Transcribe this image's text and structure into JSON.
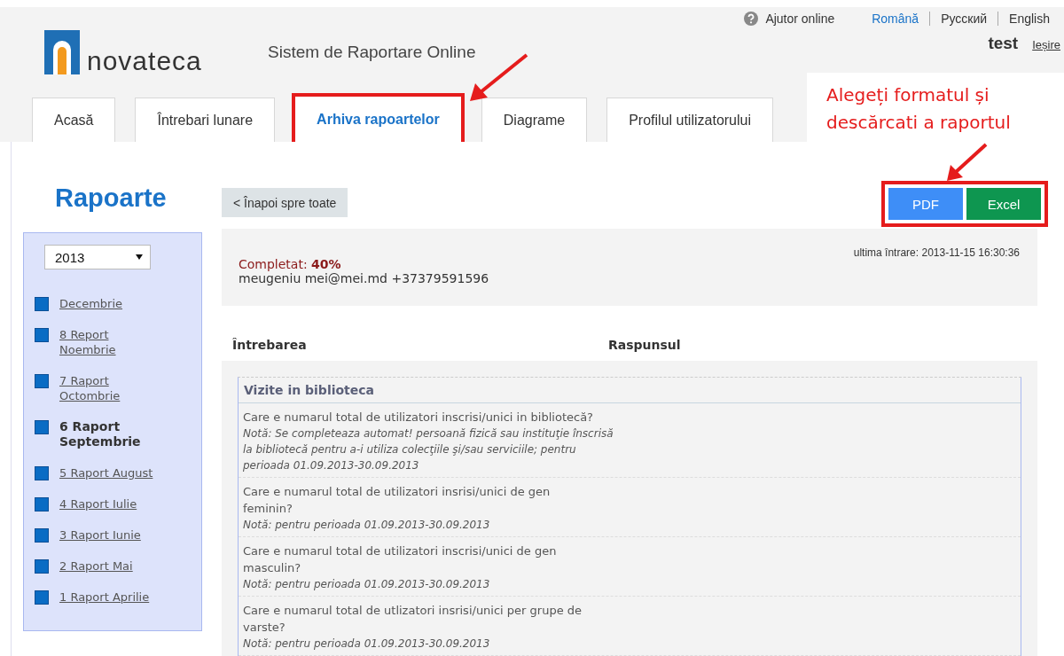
{
  "header": {
    "help_link": "Ajutor online",
    "languages": [
      {
        "label": "Română",
        "selected": true
      },
      {
        "label": "Русский",
        "selected": false
      },
      {
        "label": "English",
        "selected": false
      }
    ],
    "logo_text": "novateca",
    "site_title": "Sistem de Raportare Online",
    "user": "test",
    "logout": "Ieșire"
  },
  "tabs": [
    {
      "label": "Acasă",
      "selected": false,
      "highlighted": false
    },
    {
      "label": "Întrebari lunare",
      "selected": false,
      "highlighted": false
    },
    {
      "label": "Arhiva rapoartelor",
      "selected": true,
      "highlighted": true
    },
    {
      "label": "Diagrame",
      "selected": false,
      "highlighted": false
    },
    {
      "label": "Profilul utilizatorului",
      "selected": false,
      "highlighted": false
    }
  ],
  "callout": "Alegeți formatul și descărcati a raportul",
  "sidebar": {
    "title": "Rapoarte",
    "year": "2013",
    "items": [
      {
        "label": "Decembrie",
        "selected": false
      },
      {
        "label": "8 Report Noembrie",
        "selected": false
      },
      {
        "label": "7 Raport Octombrie",
        "selected": false
      },
      {
        "label": "6 Raport Septembrie",
        "selected": true
      },
      {
        "label": "5 Raport August",
        "selected": false
      },
      {
        "label": "4 Raport Iulie",
        "selected": false
      },
      {
        "label": "3 Raport Iunie",
        "selected": false
      },
      {
        "label": "2 Raport Mai",
        "selected": false
      },
      {
        "label": "1 Raport Aprilie",
        "selected": false
      }
    ]
  },
  "back_button": "< Înapoi spre toate",
  "export_buttons": [
    {
      "label": "PDF",
      "kind": "pdf"
    },
    {
      "label": "Excel",
      "kind": "excel"
    }
  ],
  "report": {
    "completion": "Completat: **40%**",
    "contact": "meugeniu mei@mei.md +37379591596",
    "last_entry": "ultima întrare: 2013-11-15 16:30:36"
  },
  "table": {
    "columns": [
      "Întrebarea",
      "Raspunsul"
    ],
    "section": "Vizite in biblioteca",
    "rows": [
      {
        "question": "Care e numarul total de utilizatori inscrisi/unici in bibliotecă?",
        "note": "Notă: Se completeaza automat! persoană fizică sau instituţie înscrisă la bibliotecă pentru a-i utiliza colecţiile şi/sau serviciile; pentru perioada 01.09.2013-30.09.2013"
      },
      {
        "question": "Care e numarul total de utilizatori insrisi/unici de gen feminin?",
        "note": "Notă: pentru perioada 01.09.2013-30.09.2013"
      },
      {
        "question": "Care e numarul total de utilizatori inscrisi/unici de gen masculin?",
        "note": "Notă: pentru perioada 01.09.2013-30.09.2013"
      },
      {
        "question": "Care e numarul total de utlizatori insrisi/unici per grupe de varste?",
        "note": "Notă: pentru perioada 01.09.2013-30.09.2013"
      }
    ]
  }
}
